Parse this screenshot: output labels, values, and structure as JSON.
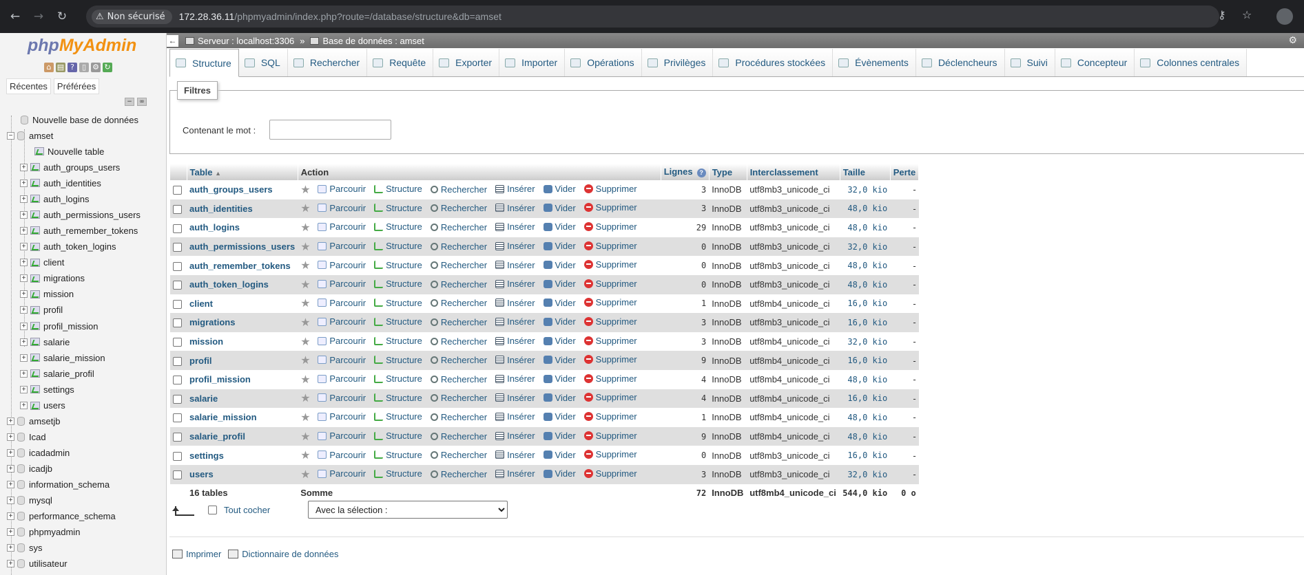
{
  "browser": {
    "security_label": "Non sécurisé",
    "url_host": "172.28.36.11",
    "url_path": "/phpmyadmin/index.php?route=/database/structure&db=amset"
  },
  "sidebar": {
    "logo_php": "php",
    "logo_myadmin": "MyAdmin",
    "tab_recent": "Récentes",
    "tab_favorites": "Préférées",
    "new_database": "Nouvelle base de données",
    "current_db": "amset",
    "new_table": "Nouvelle table",
    "tables": [
      "auth_groups_users",
      "auth_identities",
      "auth_logins",
      "auth_permissions_users",
      "auth_remember_tokens",
      "auth_token_logins",
      "client",
      "migrations",
      "mission",
      "profil",
      "profil_mission",
      "salarie",
      "salarie_mission",
      "salarie_profil",
      "settings",
      "users"
    ],
    "other_dbs": [
      "amsetjb",
      "Icad",
      "icadadmin",
      "icadjb",
      "information_schema",
      "mysql",
      "performance_schema",
      "phpmyadmin",
      "sys",
      "utilisateur"
    ]
  },
  "breadcrumb": {
    "server": "Serveur : localhost:3306",
    "separator": "»",
    "database": "Base de données : amset"
  },
  "tabs": [
    "Structure",
    "SQL",
    "Rechercher",
    "Requête",
    "Exporter",
    "Importer",
    "Opérations",
    "Privilèges",
    "Procédures stockées",
    "Évènements",
    "Déclencheurs",
    "Suivi",
    "Concepteur",
    "Colonnes centrales"
  ],
  "filters": {
    "legend": "Filtres",
    "label": "Contenant le mot :",
    "value": ""
  },
  "table": {
    "headers": {
      "table": "Table",
      "action": "Action",
      "rows": "Lignes",
      "type": "Type",
      "collation": "Interclassement",
      "size": "Taille",
      "overhead": "Perte"
    },
    "actions": {
      "browse": "Parcourir",
      "structure": "Structure",
      "search": "Rechercher",
      "insert": "Insérer",
      "empty": "Vider",
      "drop": "Supprimer"
    },
    "rows": [
      {
        "name": "auth_groups_users",
        "rows": "3",
        "type": "InnoDB",
        "collation": "utf8mb3_unicode_ci",
        "size": "32,0 kio",
        "overhead": "-"
      },
      {
        "name": "auth_identities",
        "rows": "3",
        "type": "InnoDB",
        "collation": "utf8mb3_unicode_ci",
        "size": "48,0 kio",
        "overhead": "-"
      },
      {
        "name": "auth_logins",
        "rows": "29",
        "type": "InnoDB",
        "collation": "utf8mb3_unicode_ci",
        "size": "48,0 kio",
        "overhead": "-"
      },
      {
        "name": "auth_permissions_users",
        "rows": "0",
        "type": "InnoDB",
        "collation": "utf8mb3_unicode_ci",
        "size": "32,0 kio",
        "overhead": "-"
      },
      {
        "name": "auth_remember_tokens",
        "rows": "0",
        "type": "InnoDB",
        "collation": "utf8mb3_unicode_ci",
        "size": "48,0 kio",
        "overhead": "-"
      },
      {
        "name": "auth_token_logins",
        "rows": "0",
        "type": "InnoDB",
        "collation": "utf8mb3_unicode_ci",
        "size": "48,0 kio",
        "overhead": "-"
      },
      {
        "name": "client",
        "rows": "1",
        "type": "InnoDB",
        "collation": "utf8mb4_unicode_ci",
        "size": "16,0 kio",
        "overhead": "-"
      },
      {
        "name": "migrations",
        "rows": "3",
        "type": "InnoDB",
        "collation": "utf8mb3_unicode_ci",
        "size": "16,0 kio",
        "overhead": "-"
      },
      {
        "name": "mission",
        "rows": "3",
        "type": "InnoDB",
        "collation": "utf8mb4_unicode_ci",
        "size": "32,0 kio",
        "overhead": "-"
      },
      {
        "name": "profil",
        "rows": "9",
        "type": "InnoDB",
        "collation": "utf8mb4_unicode_ci",
        "size": "16,0 kio",
        "overhead": "-"
      },
      {
        "name": "profil_mission",
        "rows": "4",
        "type": "InnoDB",
        "collation": "utf8mb4_unicode_ci",
        "size": "48,0 kio",
        "overhead": "-"
      },
      {
        "name": "salarie",
        "rows": "4",
        "type": "InnoDB",
        "collation": "utf8mb4_unicode_ci",
        "size": "16,0 kio",
        "overhead": "-"
      },
      {
        "name": "salarie_mission",
        "rows": "1",
        "type": "InnoDB",
        "collation": "utf8mb4_unicode_ci",
        "size": "48,0 kio",
        "overhead": "-"
      },
      {
        "name": "salarie_profil",
        "rows": "9",
        "type": "InnoDB",
        "collation": "utf8mb4_unicode_ci",
        "size": "48,0 kio",
        "overhead": "-"
      },
      {
        "name": "settings",
        "rows": "0",
        "type": "InnoDB",
        "collation": "utf8mb3_unicode_ci",
        "size": "16,0 kio",
        "overhead": "-"
      },
      {
        "name": "users",
        "rows": "3",
        "type": "InnoDB",
        "collation": "utf8mb3_unicode_ci",
        "size": "32,0 kio",
        "overhead": "-"
      }
    ],
    "footer": {
      "count": "16 tables",
      "label": "Somme",
      "rows": "72",
      "type": "InnoDB",
      "collation": "utf8mb4_unicode_ci",
      "size": "544,0 kio",
      "overhead": "0 o"
    }
  },
  "bulk": {
    "check_all": "Tout cocher",
    "select_placeholder": "Avec la sélection :"
  },
  "footer_links": {
    "print": "Imprimer",
    "dictionary": "Dictionnaire de données"
  }
}
